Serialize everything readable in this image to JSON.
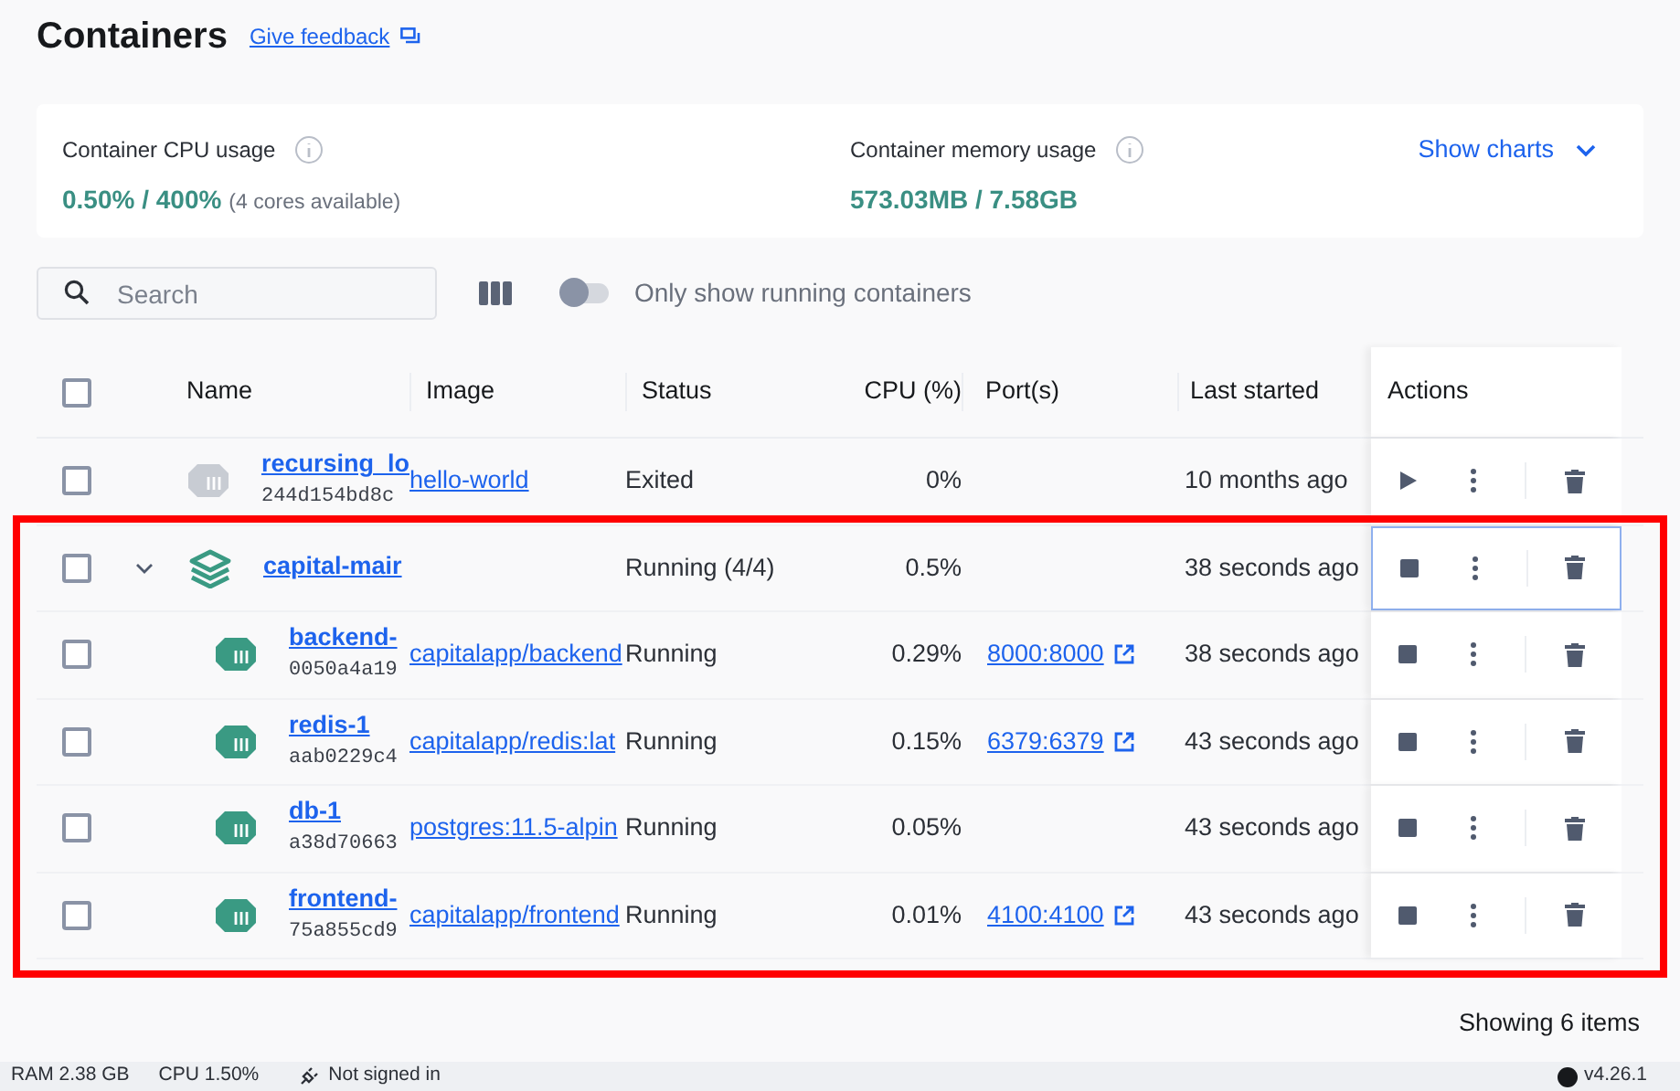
{
  "header": {
    "title": "Containers",
    "feedback_link": "Give feedback"
  },
  "usage": {
    "cpu_label": "Container CPU usage",
    "cpu_value": "0.50% / 400%",
    "cpu_note": "(4 cores available)",
    "memory_label": "Container memory usage",
    "memory_value": "573.03MB / 7.58GB",
    "charts_button": "Show charts"
  },
  "toolbar": {
    "search": {
      "placeholder": "Search"
    },
    "running_toggle": {
      "label": "Only show running containers",
      "on": false
    }
  },
  "table": {
    "select_all_checked": false,
    "columns": [
      "Name",
      "Image",
      "Status",
      "CPU (%)",
      "Port(s)",
      "Last started",
      "Actions"
    ],
    "rows": [
      {
        "kind": "container",
        "checked": false,
        "selected": false,
        "running": false,
        "name": "recursing_lo",
        "id": "244d154bd8c",
        "image": "hello-world",
        "status": "Exited",
        "cpu": "0%",
        "last_started": "10 months ago"
      },
      {
        "kind": "group",
        "checked": false,
        "selected": true,
        "running": true,
        "expanded": true,
        "name": "capital-mair",
        "status": "Running (4/4)",
        "cpu": "0.5%",
        "last_started": "38 seconds ago",
        "highlighted": true,
        "children": [
          {
            "kind": "container",
            "checked": false,
            "selected": false,
            "running": true,
            "name": "backend-",
            "id": "0050a4a19",
            "image": "capitalapp/backend",
            "status": "Running",
            "cpu": "0.29%",
            "port": "8000:8000",
            "last_started": "38 seconds ago"
          },
          {
            "kind": "container",
            "checked": false,
            "selected": false,
            "running": true,
            "name": "redis-1",
            "id": "aab0229c4",
            "image": "capitalapp/redis:lat",
            "status": "Running",
            "cpu": "0.15%",
            "port": "6379:6379",
            "last_started": "43 seconds ago"
          },
          {
            "kind": "container",
            "checked": false,
            "selected": false,
            "running": true,
            "name": "db-1",
            "id": "a38d70663",
            "image": "postgres:11.5-alpin",
            "status": "Running",
            "cpu": "0.05%",
            "last_started": "43 seconds ago"
          },
          {
            "kind": "container",
            "checked": false,
            "selected": false,
            "running": true,
            "name": "frontend-",
            "id": "75a855cd9",
            "image": "capitalapp/frontend",
            "status": "Running",
            "cpu": "0.01%",
            "port": "4100:4100",
            "last_started": "43 seconds ago"
          }
        ]
      }
    ]
  },
  "footer": {
    "count": "Showing 6 items"
  },
  "status_bar": {
    "ram": "RAM 2.38 GB",
    "cpu": "CPU 1.50%",
    "sign_in": "Not signed in",
    "version": "v4.26.1"
  }
}
